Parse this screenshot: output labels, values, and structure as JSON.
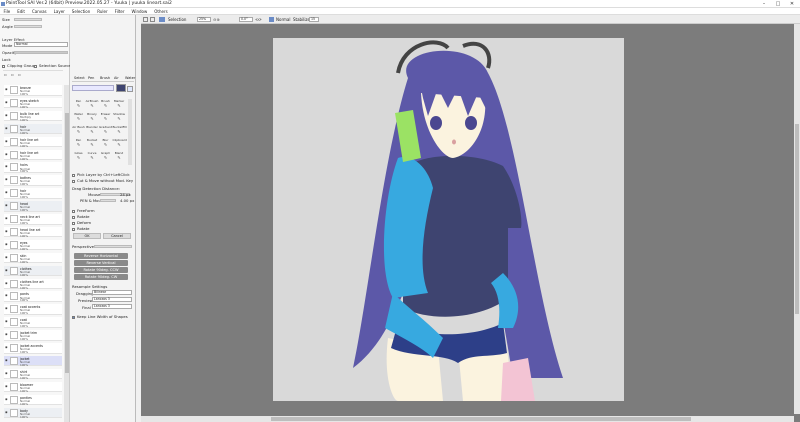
{
  "window": {
    "title": "PaintTool SAI Ver.2 (64bit) Preview.2022.05.27 - Yuuka | yuuka lineart.sai2",
    "controls": [
      "–",
      "□",
      "✕"
    ]
  },
  "menu": [
    "File",
    "Edit",
    "Canvas",
    "Layer",
    "Selection",
    "Ruler",
    "Filter",
    "Window",
    "Others"
  ],
  "left": {
    "size_label": "Size",
    "size_value": "4.5",
    "angle_label": "Angle",
    "angle_value": "0°",
    "layer_effect": "Layer Effect",
    "mode_label": "Mode",
    "mode_value": "Normal",
    "opacity_label": "Opacity",
    "opacity_value": "100%",
    "lock_label": "Lock",
    "clipping_label": "Clipping Group",
    "selsource_label": "Selection Source"
  },
  "layers": [
    {
      "name": "bronze",
      "mode": "Normal",
      "opacity": "100%",
      "kind": "layer"
    },
    {
      "name": "eyes sketch",
      "mode": "Normal",
      "opacity": "100%",
      "kind": "layer"
    },
    {
      "name": "bulb line art",
      "mode": "Multiply",
      "opacity": "100%",
      "kind": "layer"
    },
    {
      "name": "hair",
      "mode": "Normal",
      "opacity": "100%",
      "kind": "group"
    },
    {
      "name": "hair line art",
      "mode": "Normal",
      "opacity": "100%",
      "kind": "layer"
    },
    {
      "name": "hair line art",
      "mode": "Normal",
      "opacity": "100%",
      "kind": "layer"
    },
    {
      "name": "hairs",
      "mode": "Normal",
      "opacity": "100%",
      "kind": "layer"
    },
    {
      "name": "bathes",
      "mode": "Normal",
      "opacity": "100%",
      "kind": "layer"
    },
    {
      "name": "hair",
      "mode": "Normal",
      "opacity": "100%",
      "kind": "layer"
    },
    {
      "name": "head",
      "mode": "Normal",
      "opacity": "100%",
      "kind": "group"
    },
    {
      "name": "neck line art",
      "mode": "Normal",
      "opacity": "100%",
      "kind": "layer"
    },
    {
      "name": "head line art",
      "mode": "Normal",
      "opacity": "100%",
      "kind": "layer"
    },
    {
      "name": "eyes",
      "mode": "Normal",
      "opacity": "100%",
      "kind": "layer"
    },
    {
      "name": "skin",
      "mode": "Normal",
      "opacity": "100%",
      "kind": "layer"
    },
    {
      "name": "clothes",
      "mode": "Normal",
      "opacity": "100%",
      "kind": "group"
    },
    {
      "name": "clothes line art",
      "mode": "Normal",
      "opacity": "100%",
      "kind": "layer"
    },
    {
      "name": "pants",
      "mode": "Normal",
      "opacity": "100%",
      "kind": "layer"
    },
    {
      "name": "coat accents",
      "mode": "Normal",
      "opacity": "100%",
      "kind": "layer"
    },
    {
      "name": "coat",
      "mode": "Normal",
      "opacity": "100%",
      "kind": "layer"
    },
    {
      "name": "jacket trim",
      "mode": "Normal",
      "opacity": "100%",
      "kind": "layer"
    },
    {
      "name": "jacket accents",
      "mode": "Normal",
      "opacity": "100%",
      "kind": "layer"
    },
    {
      "name": "jacket",
      "mode": "Normal",
      "opacity": "100%",
      "kind": "layer",
      "selected": true
    },
    {
      "name": "shirt",
      "mode": "Normal",
      "opacity": "100%",
      "kind": "layer"
    },
    {
      "name": "bloomer",
      "mode": "Normal",
      "opacity": "100%",
      "kind": "layer"
    },
    {
      "name": "panties",
      "mode": "Normal",
      "opacity": "100%",
      "kind": "layer"
    },
    {
      "name": "body",
      "mode": "Normal",
      "opacity": "100%",
      "kind": "group"
    }
  ],
  "tools": {
    "tabs": [
      "Select",
      "Pen",
      "Brush",
      "Air",
      "Water"
    ],
    "items": [
      "Pen",
      "AirBrush",
      "Brush",
      "Marker",
      "Water",
      "Binary",
      "Eraser",
      "Shadow",
      "Air Bush",
      "Blender",
      "Gradient",
      "BucketFill",
      "Pen",
      "Bucket",
      "Blur",
      "Clipboard",
      "Gloss",
      "Curve",
      "Graph",
      "Blend"
    ],
    "hide_layer": "Pick Layer by Ctrl+LeftClick",
    "cut_move": "Cut & Move without Mod. Key",
    "drag_label": "Drag Detection Distance:",
    "mouse_label": "Mouse",
    "mouse_value": "24 px",
    "pen_label": "PEN & Mouse",
    "pen_value": "4.00 px",
    "free_label": "FreeForm",
    "rotate_label": "Rotate",
    "deform_label": "Deform",
    "rotate2_label": "Rotate",
    "ok": "OK",
    "cancel": "Cancel",
    "perspective_label": "Perspective",
    "reverse_h": "Reverse Horizontal",
    "reverse_v": "Reverse Vertical",
    "rotate_ccw": "Rotate 90deg. CCW",
    "rotate_cw": "Rotate 90deg. CW",
    "resample_label": "Resample Settings",
    "dragging_label": "Dragging",
    "dragging_value": "Bilinear",
    "preview_label": "Preview",
    "preview_value": "Lanczos 3",
    "final_label": "Final",
    "final_value": "Lanczos 3",
    "keep_label": "Keep Line Width of Shapes"
  },
  "topbar": {
    "selection_label": "Selection",
    "zoom": "25%",
    "rotation": "0.0°",
    "normal_label": "Normal",
    "stabilizer_label": "Stabilizer",
    "stabilizer_value": "15"
  },
  "colors": {
    "hair": "#5c58a8",
    "shirt": "#3e4470",
    "jacket": "#37a9e0",
    "skin": "#fbf3df",
    "canvas_bg": "#d9d9d9",
    "phone": "#9be264",
    "workspace": "#7c7c7c"
  }
}
